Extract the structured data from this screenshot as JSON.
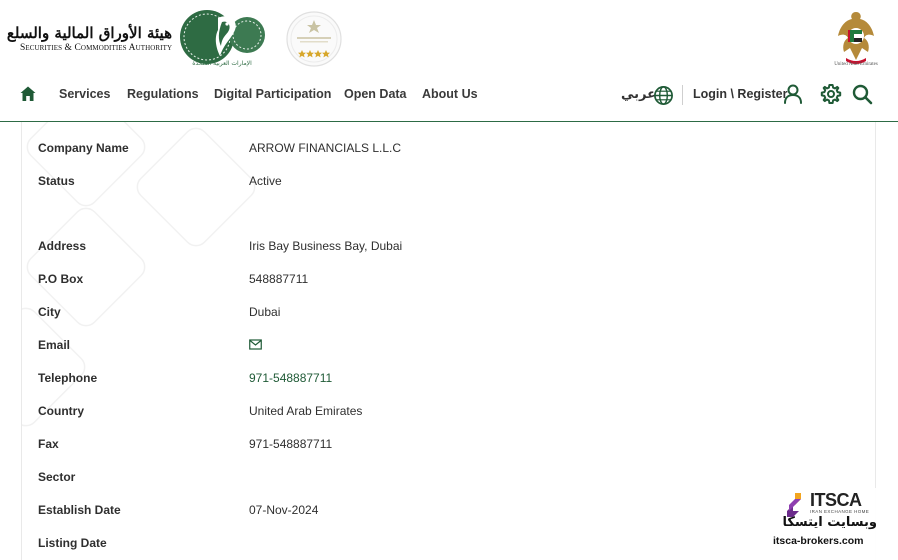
{
  "header": {
    "sca_logo": {
      "arabic_text": "هيئة الأوراق المالية والسلع",
      "english_text": "Securities & Commodities Authority",
      "emblem_caption": "الإمارات العربية المتحدة"
    },
    "uae_emblem_caption": "United Arab Emirates"
  },
  "nav": {
    "home_icon": "home-icon",
    "items": [
      "Services",
      "Regulations",
      "Digital Participation",
      "Open Data",
      "About Us"
    ],
    "language_label": "عربي",
    "login_label": "Login \\ Register"
  },
  "colors": {
    "brand_green": "#1f5a36",
    "header_border": "#2d6b45"
  },
  "details": [
    {
      "label": "Company Name",
      "value": "ARROW FINANCIALS L.L.C"
    },
    {
      "label": "Status",
      "value": "Active"
    },
    {
      "label": "Address",
      "value": "Iris Bay Business Bay, Dubai"
    },
    {
      "label": "P.O Box",
      "value": "548887711"
    },
    {
      "label": "City",
      "value": "Dubai"
    },
    {
      "label": "Email",
      "value": "",
      "icon": "mail-icon"
    },
    {
      "label": "Telephone",
      "value": "971-548887711"
    },
    {
      "label": "Country",
      "value": "United Arab Emirates"
    },
    {
      "label": "Fax",
      "value": "971-548887711"
    },
    {
      "label": "Sector",
      "value": ""
    },
    {
      "label": "Establish Date",
      "value": "07-Nov-2024"
    },
    {
      "label": "Listing Date",
      "value": ""
    }
  ],
  "watermark": {
    "brand": "ITSCA",
    "tagline": "IRAN EXCHANGE HOME",
    "arabic_text": "وبسایت ایتسکا",
    "url": "itsca-brokers.com"
  }
}
